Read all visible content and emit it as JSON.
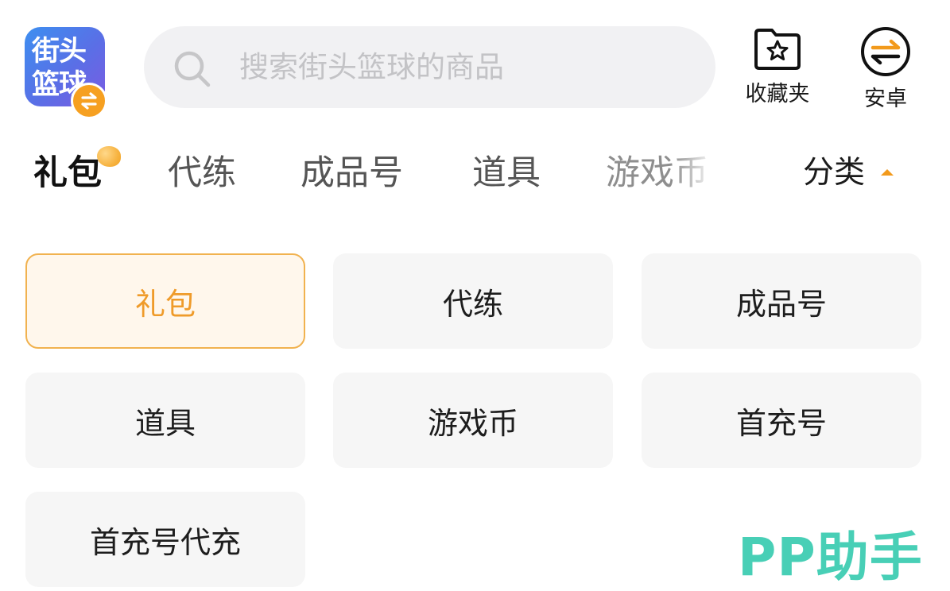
{
  "header": {
    "logo_text": "街头篮球",
    "search_placeholder": "搜索街头篮球的商品",
    "favorites_label": "收藏夹",
    "android_label": "安卓"
  },
  "tabs": {
    "items": [
      {
        "label": "礼包",
        "active": true
      },
      {
        "label": "代练",
        "active": false
      },
      {
        "label": "成品号",
        "active": false
      },
      {
        "label": "道具",
        "active": false
      },
      {
        "label": "游戏币",
        "active": false
      }
    ],
    "category_label": "分类"
  },
  "categories": {
    "items": [
      {
        "label": "礼包",
        "selected": true
      },
      {
        "label": "代练",
        "selected": false
      },
      {
        "label": "成品号",
        "selected": false
      },
      {
        "label": "道具",
        "selected": false
      },
      {
        "label": "游戏币",
        "selected": false
      },
      {
        "label": "首充号",
        "selected": false
      },
      {
        "label": "首充号代充",
        "selected": false
      }
    ]
  },
  "watermark": "PP助手",
  "colors": {
    "accent": "#f29a1c",
    "selected_border": "#f1b24f",
    "selected_text": "#ef9b2a",
    "watermark": "#48cfb6",
    "logo_gradient_start": "#3d8ff0",
    "logo_gradient_end": "#7b5be2"
  },
  "icons": {
    "search": "search-icon",
    "favorites": "star-folder-icon",
    "android": "swap-arrows-icon",
    "logo_badge": "swap-badge-icon"
  }
}
